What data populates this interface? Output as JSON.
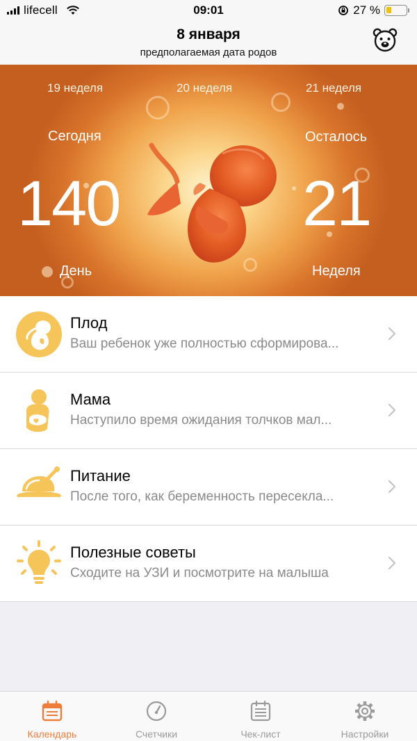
{
  "status_bar": {
    "carrier": "lifecell",
    "time": "09:01",
    "battery": "27 %",
    "battery_level": 0.27
  },
  "header": {
    "title": "8 января",
    "subtitle": "предполагаемая дата родов",
    "profile_icon": "bear-icon"
  },
  "hero": {
    "weeks": [
      "19 неделя",
      "20 неделя",
      "21 неделя"
    ],
    "today_label": "Сегодня",
    "day_value": "140",
    "day_label": "День",
    "left_label": "Осталось",
    "week_value": "21",
    "week_label": "Неделя"
  },
  "items": [
    {
      "title": "Плод",
      "desc": "Ваш ребенок уже полностью сформирова...",
      "icon": "fetus-icon"
    },
    {
      "title": "Мама",
      "desc": "Наступило время ожидания толчков мал...",
      "icon": "mother-baby-icon"
    },
    {
      "title": "Питание",
      "desc": "После того, как беременность пересекла...",
      "icon": "roast-chicken-icon"
    },
    {
      "title": "Полезные советы",
      "desc": "Сходите на УЗИ и посмотрите на малыша",
      "icon": "lightbulb-icon"
    }
  ],
  "tabs": [
    {
      "label": "Календарь",
      "icon": "calendar-icon",
      "active": true
    },
    {
      "label": "Счетчики",
      "icon": "gauge-icon",
      "active": false
    },
    {
      "label": "Чек-лист",
      "icon": "checklist-icon",
      "active": false
    },
    {
      "label": "Настройки",
      "icon": "gear-icon",
      "active": false
    }
  ],
  "colors": {
    "accent": "#ee7d3b",
    "icon_yellow": "#f6c55a",
    "hero_orange": "#d8732b"
  }
}
